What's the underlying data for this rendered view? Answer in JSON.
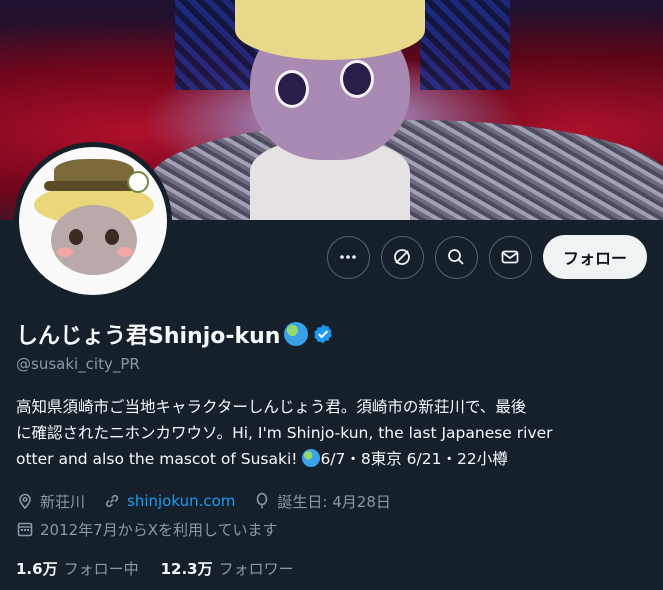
{
  "profile": {
    "display_name": "しんじょう君Shinjo-kun",
    "handle": "@susaki_city_PR",
    "bio_line1": "高知県須崎市ご当地キャラクターしんじょう君。須崎市の新荘川で、最後",
    "bio_line2": "に確認されたニホンカワウソ。Hi, I'm Shinjo-kun, the last Japanese river",
    "bio_line3_a": "otter and also the mascot of Susaki! ",
    "bio_line3_b": "6/7・8東京 6/21・22小樽",
    "location": "新荘川",
    "website": "shinjokun.com",
    "birthday": "誕生日: 4月28日",
    "joined": "2012年7月からXを利用しています",
    "following_count": "1.6万",
    "following_label": "フォロー中",
    "followers_count": "12.3万",
    "followers_label": "フォロワー"
  },
  "actions": {
    "follow_label": "フォロー"
  },
  "icons": {
    "more": "more-icon",
    "grok": "grok-icon",
    "search": "search-icon",
    "message": "mail-icon",
    "verified": "verified-badge-icon",
    "globe": "globe-emoji-icon"
  },
  "colors": {
    "background": "#15202b",
    "link": "#1d9bf0",
    "muted": "#8b98a5",
    "follow_button": "#eff3f4"
  }
}
